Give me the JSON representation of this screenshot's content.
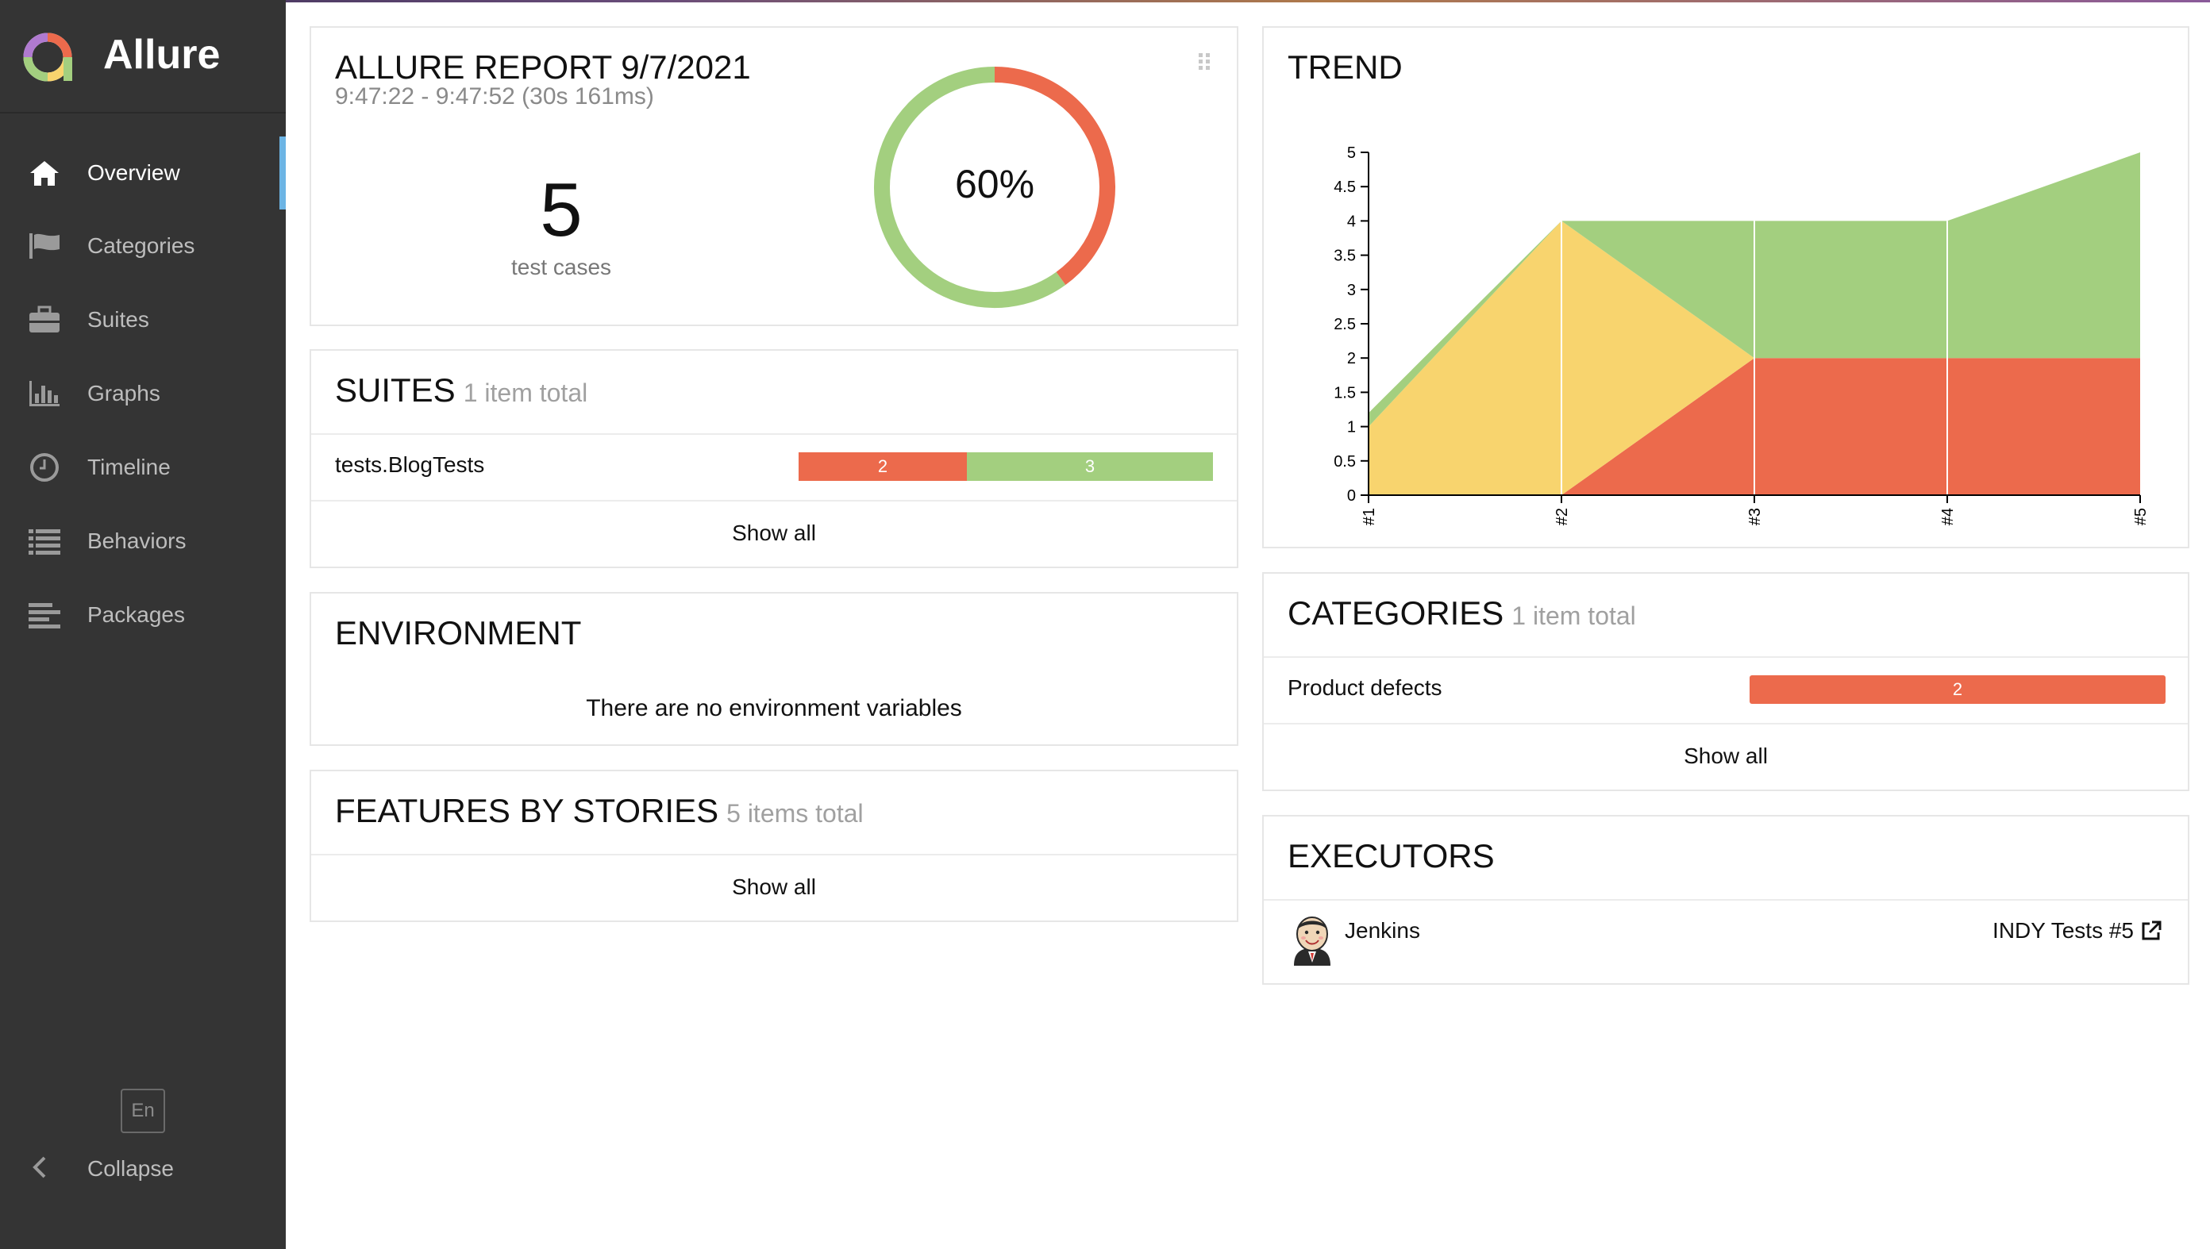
{
  "app": {
    "name": "Allure"
  },
  "sidebar": {
    "items": [
      {
        "label": "Overview",
        "icon": "home-icon",
        "active": true
      },
      {
        "label": "Categories",
        "icon": "flag-icon",
        "active": false
      },
      {
        "label": "Suites",
        "icon": "briefcase-icon",
        "active": false
      },
      {
        "label": "Graphs",
        "icon": "bar-chart-icon",
        "active": false
      },
      {
        "label": "Timeline",
        "icon": "clock-icon",
        "active": false
      },
      {
        "label": "Behaviors",
        "icon": "list-icon",
        "active": false
      },
      {
        "label": "Packages",
        "icon": "align-left-icon",
        "active": false
      }
    ],
    "language": "En",
    "collapse_label": "Collapse"
  },
  "summary": {
    "title": "ALLURE REPORT 9/7/2021",
    "time_range": "9:47:22 - 9:47:52 (30s 161ms)",
    "test_count": "5",
    "test_count_label": "test cases",
    "percent_label": "60%",
    "passed_fraction": 0.6,
    "colors": {
      "passed": "#a3cf7f",
      "failed": "#ec6a4c"
    }
  },
  "suites": {
    "title": "SUITES",
    "subtitle": "1 item total",
    "rows": [
      {
        "name": "tests.BlogTests",
        "failed": "2",
        "passed": "3",
        "failed_n": 2,
        "passed_n": 3
      }
    ],
    "show_all": "Show all"
  },
  "environment": {
    "title": "ENVIRONMENT",
    "message": "There are no environment variables"
  },
  "features": {
    "title": "FEATURES BY STORIES",
    "subtitle": "5 items total",
    "show_all": "Show all"
  },
  "trend": {
    "title": "TREND"
  },
  "chart_data": {
    "type": "area",
    "x": [
      "#1",
      "#2",
      "#3",
      "#4",
      "#5"
    ],
    "series": [
      {
        "status": "failed",
        "color": "#ec6a4c",
        "values": [
          0,
          0,
          2,
          2,
          2
        ]
      },
      {
        "status": "broken",
        "color": "#f8d46e",
        "values": [
          1,
          4,
          0,
          0,
          0
        ]
      },
      {
        "status": "passed",
        "color": "#a3cf7f",
        "values": [
          0.2,
          0,
          2,
          2,
          3
        ]
      }
    ],
    "ylim": [
      0,
      5
    ],
    "yticks": [
      "0",
      "0.5",
      "1",
      "1.5",
      "2",
      "2.5",
      "3",
      "3.5",
      "4",
      "4.5",
      "5"
    ],
    "stacked": true
  },
  "categories": {
    "title": "CATEGORIES",
    "subtitle": "1 item total",
    "rows": [
      {
        "name": "Product defects",
        "count": "2"
      }
    ],
    "show_all": "Show all"
  },
  "executors": {
    "title": "EXECUTORS",
    "rows": [
      {
        "name": "Jenkins",
        "link": "INDY Tests #5",
        "avatar": "jenkins-avatar-icon",
        "link_icon": "external-link-icon"
      }
    ]
  }
}
